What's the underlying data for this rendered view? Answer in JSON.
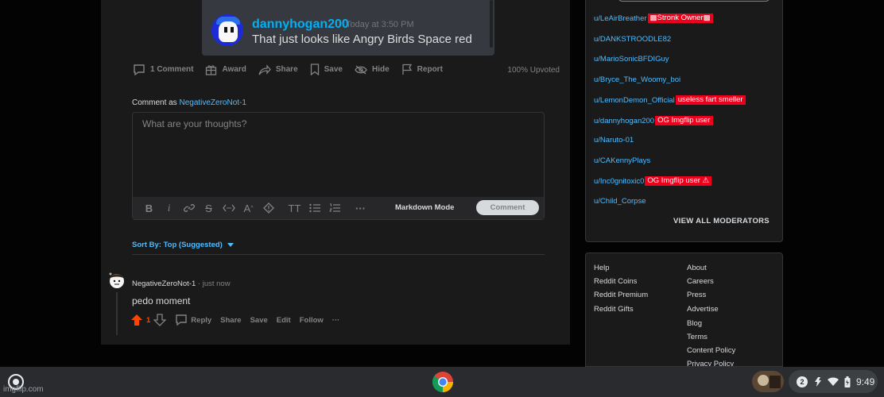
{
  "embed": {
    "username": "dannyhogan200",
    "timestamp": "Today at 3:50 PM",
    "message": "That just looks like Angry Birds Space red"
  },
  "post_actions": {
    "comments": "1 Comment",
    "award": "Award",
    "share": "Share",
    "save": "Save",
    "hide": "Hide",
    "report": "Report",
    "upvoted": "100% Upvoted"
  },
  "composer": {
    "comment_as_label": "Comment as",
    "username": "NegativeZeroNot-1",
    "placeholder": "What are your thoughts?",
    "markdown_mode": "Markdown Mode",
    "submit": "Comment"
  },
  "sort": {
    "label": "Sort By: Top (Suggested)"
  },
  "comment": {
    "author": "NegativeZeroNot-1",
    "meta": "· just now",
    "text": "pedo moment",
    "score": "1",
    "reply": "Reply",
    "share": "Share",
    "save": "Save",
    "edit": "Edit",
    "follow": "Follow",
    "more": "···"
  },
  "moderators": [
    {
      "name": "u/LeAirBreather",
      "flair": "Stronk Owner"
    },
    {
      "name": "u/DANKSTROODLE82",
      "flair": ""
    },
    {
      "name": "u/MarioSonicBFDIGuy",
      "flair": ""
    },
    {
      "name": "u/Bryce_The_Woomy_boi",
      "flair": ""
    },
    {
      "name": "u/LemonDemon_Official",
      "flair": "useless fart smeller"
    },
    {
      "name": "u/dannyhogan200",
      "flair": "OG Imgflip user"
    },
    {
      "name": "u/Naruto-01",
      "flair": ""
    },
    {
      "name": "u/CAKennyPlays",
      "flair": ""
    },
    {
      "name": "u/Inc0gnitoxic0",
      "flair": "OG Imgflip user"
    },
    {
      "name": "u/Child_Corpse",
      "flair": ""
    }
  ],
  "view_all_moderators": "VIEW ALL MODERATORS",
  "footer_links": {
    "left": [
      "Help",
      "Reddit Coins",
      "Reddit Premium",
      "Reddit Gifts"
    ],
    "right": [
      "About",
      "Careers",
      "Press",
      "Advertise",
      "Blog",
      "Terms",
      "Content Policy",
      "Privacy Policy"
    ]
  },
  "shelf": {
    "watermark": "imgflip.com",
    "notification_count": "2",
    "time": "9:49"
  },
  "colors": {
    "accent": "#4fbcff",
    "upvote": "#ff4500",
    "flair": "#ed001c",
    "card": "#1a1a1b"
  }
}
